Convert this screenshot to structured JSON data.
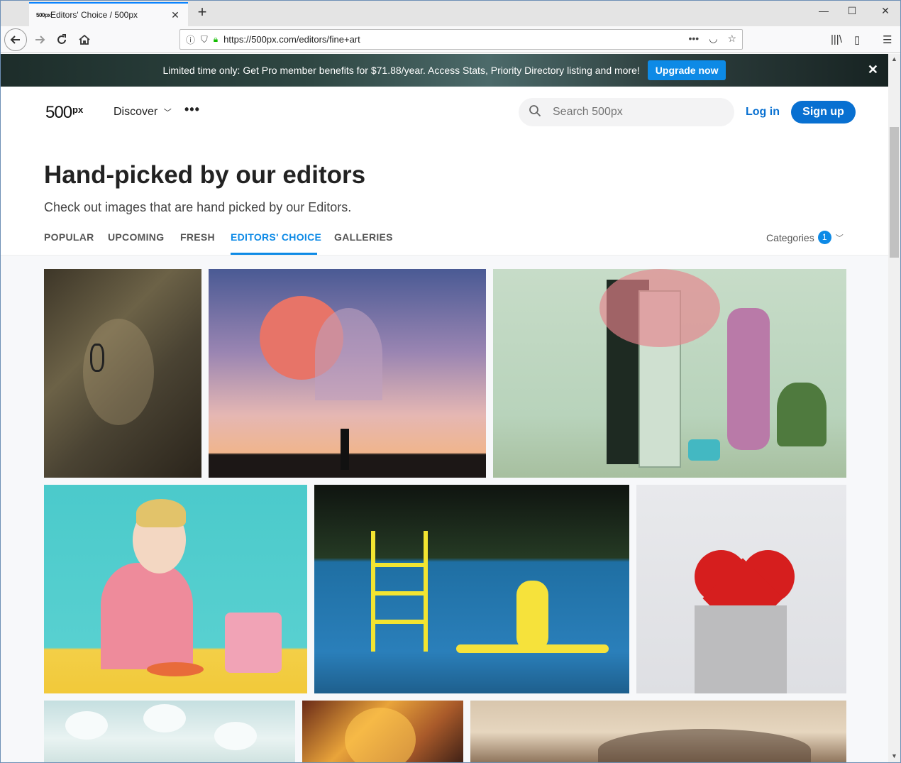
{
  "browser": {
    "tab_title": "Editors' Choice / 500px",
    "tab_favicon": "500px",
    "url": "https://500px.com/editors/fine+art",
    "icons": [
      "back-icon",
      "forward-icon",
      "reload-icon",
      "home-icon",
      "info-icon",
      "shield-icon",
      "lock-icon",
      "more-dots-icon",
      "pocket-icon",
      "star-icon",
      "library-icon",
      "sidebar-icon",
      "menu-icon",
      "minimize-icon",
      "maximize-icon",
      "close-icon",
      "new-tab-icon"
    ]
  },
  "promo": {
    "message": "Limited time only: Get Pro member benefits for $71.88/year. Access Stats, Priority Directory listing and more!",
    "button": "Upgrade now"
  },
  "header": {
    "logo_main": "500",
    "logo_sup": "px",
    "discover": "Discover",
    "search_placeholder": "Search 500px",
    "login": "Log in",
    "signup": "Sign up"
  },
  "hero": {
    "title": "Hand-picked by our editors",
    "subtitle": "Check out images that are hand picked by our Editors."
  },
  "tabs": [
    {
      "label": "POPULAR",
      "active": false
    },
    {
      "label": "UPCOMING",
      "active": false
    },
    {
      "label": "FRESH",
      "active": false
    },
    {
      "label": "EDITORS' CHOICE",
      "active": true
    },
    {
      "label": "GALLERIES",
      "active": false
    }
  ],
  "categories": {
    "label": "Categories",
    "count": "1"
  },
  "colors": {
    "accent": "#0d8ae6",
    "brand_blue": "#0870d1",
    "browser_tab_highlight": "#0a84ff"
  }
}
